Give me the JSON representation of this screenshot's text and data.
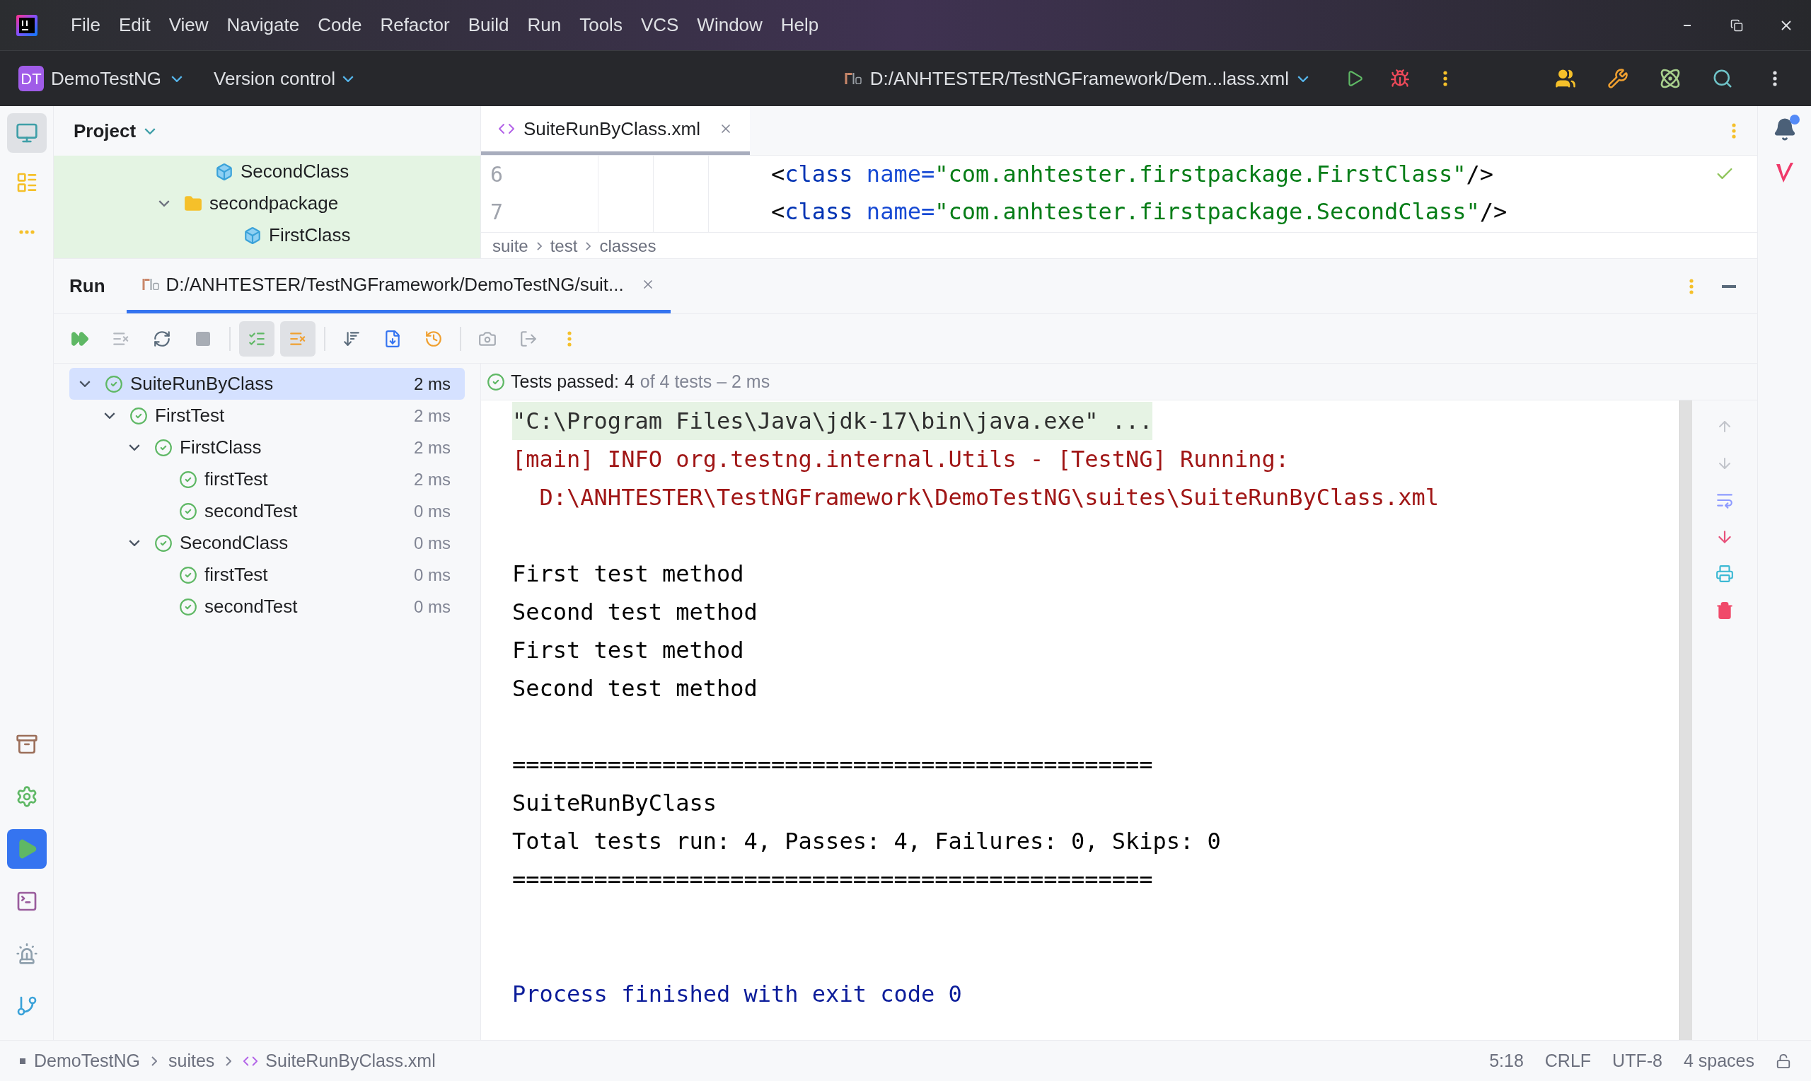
{
  "title_bar": {
    "menu": [
      "File",
      "Edit",
      "View",
      "Navigate",
      "Code",
      "Refactor",
      "Build",
      "Run",
      "Tools",
      "VCS",
      "Window",
      "Help"
    ]
  },
  "main_toolbar": {
    "project_badge": "DT",
    "project": "DemoTestNG",
    "vcs": "Version control",
    "run_config": "D:/ANHTESTER/TestNGFramework/Dem...lass.xml"
  },
  "left_toolbar": {
    "top": [
      {
        "kind": "project",
        "selected": true
      },
      {
        "kind": "structure",
        "selected": false
      },
      {
        "kind": "more",
        "selected": false
      }
    ],
    "bottom": [
      {
        "kind": "services",
        "selected": false
      },
      {
        "kind": "settings",
        "selected": false
      },
      {
        "kind": "run",
        "selected": true
      },
      {
        "kind": "terminal",
        "selected": false
      },
      {
        "kind": "problems",
        "selected": false
      },
      {
        "kind": "git",
        "selected": false
      }
    ]
  },
  "project_panel": {
    "title": "Project",
    "tree": [
      {
        "label": "SecondClass",
        "kind": "class"
      },
      {
        "label": "secondpackage",
        "kind": "package",
        "expanded": true,
        "children": [
          {
            "label": "FirstClass",
            "kind": "class"
          }
        ]
      }
    ]
  },
  "editor": {
    "tab": "SuiteRunByClass.xml",
    "lines": [
      {
        "number": "6",
        "tokens": [
          {
            "text": "<",
            "kind": "punct"
          },
          {
            "text": "class",
            "kind": "tag"
          },
          {
            "text": " name=",
            "kind": "attr"
          },
          {
            "text": "\"com.anhtester.firstpackage.FirstClass\"",
            "kind": "value"
          },
          {
            "text": "/>",
            "kind": "punct"
          }
        ]
      },
      {
        "number": "7",
        "tokens": [
          {
            "text": "<",
            "kind": "punct"
          },
          {
            "text": "class",
            "kind": "tag"
          },
          {
            "text": " name=",
            "kind": "attr"
          },
          {
            "text": "\"com.anhtester.firstpackage.SecondClass\"",
            "kind": "value"
          },
          {
            "text": "/>",
            "kind": "punct"
          }
        ]
      }
    ],
    "breadcrumbs": [
      "suite",
      "test",
      "classes"
    ]
  },
  "run_panel": {
    "title": "Run",
    "tab": "D:/ANHTESTER/TestNGFramework/DemoTestNG/suit...",
    "show_passed": true,
    "show_ignored": true,
    "tests": [
      {
        "label": "SuiteRunByClass",
        "duration": "2 ms",
        "selected": true,
        "expanded": true,
        "children": [
          {
            "label": "FirstTest",
            "duration": "2 ms",
            "selected": false,
            "expanded": true,
            "children": [
              {
                "label": "FirstClass",
                "duration": "2 ms",
                "selected": false,
                "expanded": true,
                "children": [
                  {
                    "label": "firstTest",
                    "duration": "2 ms",
                    "selected": false
                  },
                  {
                    "label": "secondTest",
                    "duration": "0 ms",
                    "selected": false
                  }
                ]
              },
              {
                "label": "SecondClass",
                "duration": "0 ms",
                "selected": false,
                "expanded": true,
                "children": [
                  {
                    "label": "firstTest",
                    "duration": "0 ms",
                    "selected": false
                  },
                  {
                    "label": "secondTest",
                    "duration": "0 ms",
                    "selected": false
                  }
                ]
              }
            ]
          }
        ]
      }
    ],
    "summary": {
      "label": "Tests passed:",
      "count": "4",
      "rest": "of 4 tests – 2 ms"
    },
    "console": [
      {
        "text": "\"C:\\Program Files\\Java\\jdk-17\\bin\\java.exe\" ...",
        "kind": "command"
      },
      {
        "text": "[main] INFO org.testng.internal.Utils - [TestNG] Running:",
        "kind": "error"
      },
      {
        "text": "  D:\\ANHTESTER\\TestNGFramework\\DemoTestNG\\suites\\SuiteRunByClass.xml",
        "kind": "error"
      },
      {
        "kind": "blank"
      },
      {
        "text": "First test method",
        "kind": "stdout"
      },
      {
        "text": "Second test method",
        "kind": "stdout"
      },
      {
        "text": "First test method",
        "kind": "stdout"
      },
      {
        "text": "Second test method",
        "kind": "stdout"
      },
      {
        "kind": "blank"
      },
      {
        "text": "===============================================",
        "kind": "stdout"
      },
      {
        "text": "SuiteRunByClass",
        "kind": "stdout"
      },
      {
        "text": "Total tests run: 4, Passes: 4, Failures: 0, Skips: 0",
        "kind": "stdout"
      },
      {
        "text": "===============================================",
        "kind": "stdout"
      },
      {
        "kind": "blank"
      },
      {
        "kind": "blank"
      },
      {
        "text": "Process finished with exit code 0",
        "kind": "exit"
      }
    ]
  },
  "status_bar": {
    "path": [
      "DemoTestNG",
      "suites",
      "SuiteRunByClass.xml"
    ],
    "items": [
      "5:18",
      "CRLF",
      "UTF-8",
      "4 spaces"
    ]
  }
}
